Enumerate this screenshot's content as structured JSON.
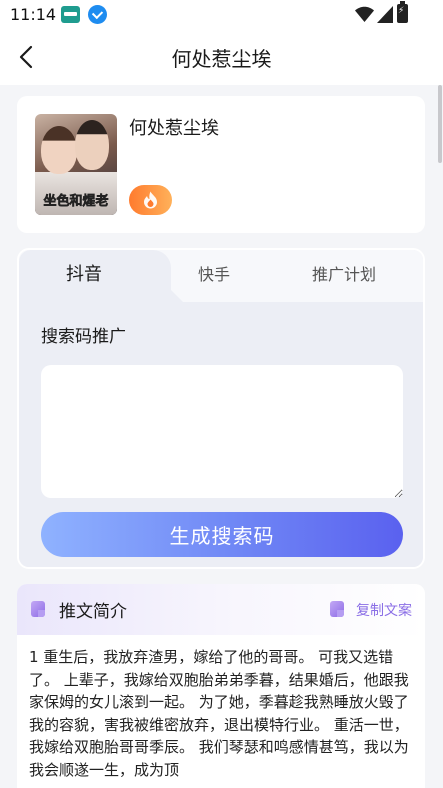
{
  "status_bar": {
    "time": "11:14",
    "icons": [
      "app-mascot-icon",
      "download-icon",
      "wifi-icon",
      "cell-signal-icon",
      "battery-charging-icon"
    ]
  },
  "nav": {
    "title": "何处惹尘埃",
    "back_icon": "chevron-left-icon"
  },
  "book": {
    "title": "何处惹尘埃",
    "cover_text": "坐色和煋老",
    "badge_icon": "flame-icon",
    "badge_color": "#ff8a35"
  },
  "promo": {
    "tabs": [
      {
        "label": "抖音",
        "active": true
      },
      {
        "label": "快手",
        "active": false
      },
      {
        "label": "推广计划",
        "active": false
      }
    ],
    "section_label": "搜索码推广",
    "input_value": "",
    "generate_button": "生成搜索码",
    "button_gradient": [
      "#8fb2ff",
      "#5a61ef"
    ]
  },
  "intro": {
    "title": "推文简介",
    "copy_label": "复制文案",
    "accent_color": "#8a6ee6",
    "text": "1 重生后，我放弃渣男，嫁给了他的哥哥。 可我又选错了。 上辈子，我嫁给双胞胎弟弟季暮，结果婚后，他跟我家保姆的女儿滚到一起。 为了她，季暮趁我熟睡放火毁了我的容貌，害我被维密放弃，退出模特行业。 重活一世，我嫁给双胞胎哥哥季辰。 我们琴瑟和鸣感情甚笃，我以为我会顺遂一生，成为顶"
  }
}
